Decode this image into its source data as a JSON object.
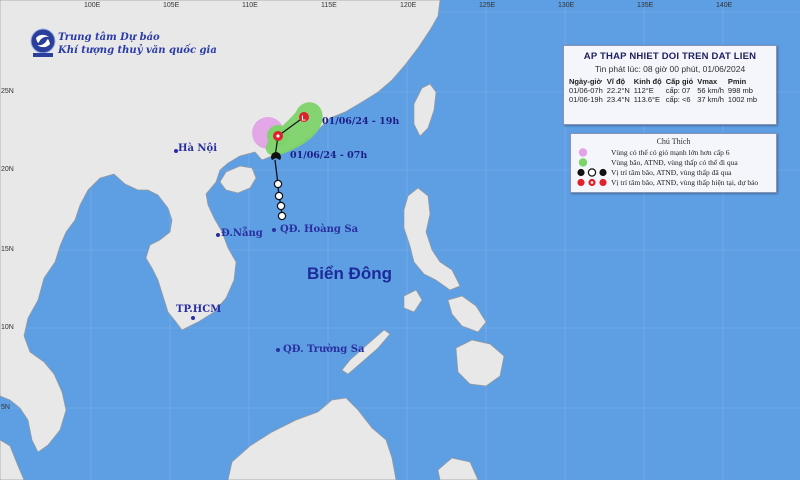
{
  "organization": {
    "line1": "Trung tâm Dự báo",
    "line2": "Khí tượng thuỷ văn quốc gia"
  },
  "bulletin": {
    "title": "AP THAP NHIET DOI TREN DAT LIEN",
    "issued": "Tin phát lúc: 08 giờ 00 phút, 01/06/2024",
    "headers": [
      "Ngày-giờ",
      "Vĩ độ",
      "Kinh độ",
      "Cấp gió",
      "Vmax",
      "Pmin"
    ],
    "rows": [
      [
        "01/06-07h",
        "22.2°N",
        "112°E",
        "cấp: 07",
        "56 km/h",
        "998 mb"
      ],
      [
        "01/06-19h",
        "23.4°N",
        "113.6°E",
        "cấp: <6",
        "37 km/h",
        "1002 mb"
      ]
    ]
  },
  "legend": {
    "title": "Chú Thích",
    "items": [
      "Vùng có thể có gió mạnh lớn hơn cấp 6",
      "Vùng bão, ATNĐ, vùng thấp có thể đi qua",
      "Vị trí tâm bão, ATNĐ, vùng thấp đã qua",
      "Vị trí tâm bão, ATNĐ, vùng thấp hiện tại, dự báo"
    ],
    "colors": {
      "strong_wind_zone": "#e3a3e8",
      "path_zone": "#7ed36b",
      "past_symbol": "#111111",
      "forecast_symbol": "#e0202a"
    }
  },
  "map": {
    "colors": {
      "sea": "#5e9ee3",
      "land": "#e8e8e8",
      "border": "#a0a0a0",
      "grid": "#7fb1ea"
    },
    "top_ticks": [
      "100E",
      "105E",
      "110E",
      "115E",
      "120E",
      "125E",
      "130E",
      "135E",
      "140E"
    ],
    "left_ticks": [
      "25N",
      "20N",
      "15N",
      "10N",
      "5N"
    ],
    "cities": [
      "Hà Nội",
      "Đ.Nẵng",
      "TP.HCM"
    ],
    "islands": [
      "QĐ. Hoàng Sa",
      "QĐ. Trường Sa"
    ],
    "sea_name": "Biển Đông",
    "track_labels": [
      "01/06/24 - 19h",
      "01/06/24 - 07h"
    ]
  }
}
